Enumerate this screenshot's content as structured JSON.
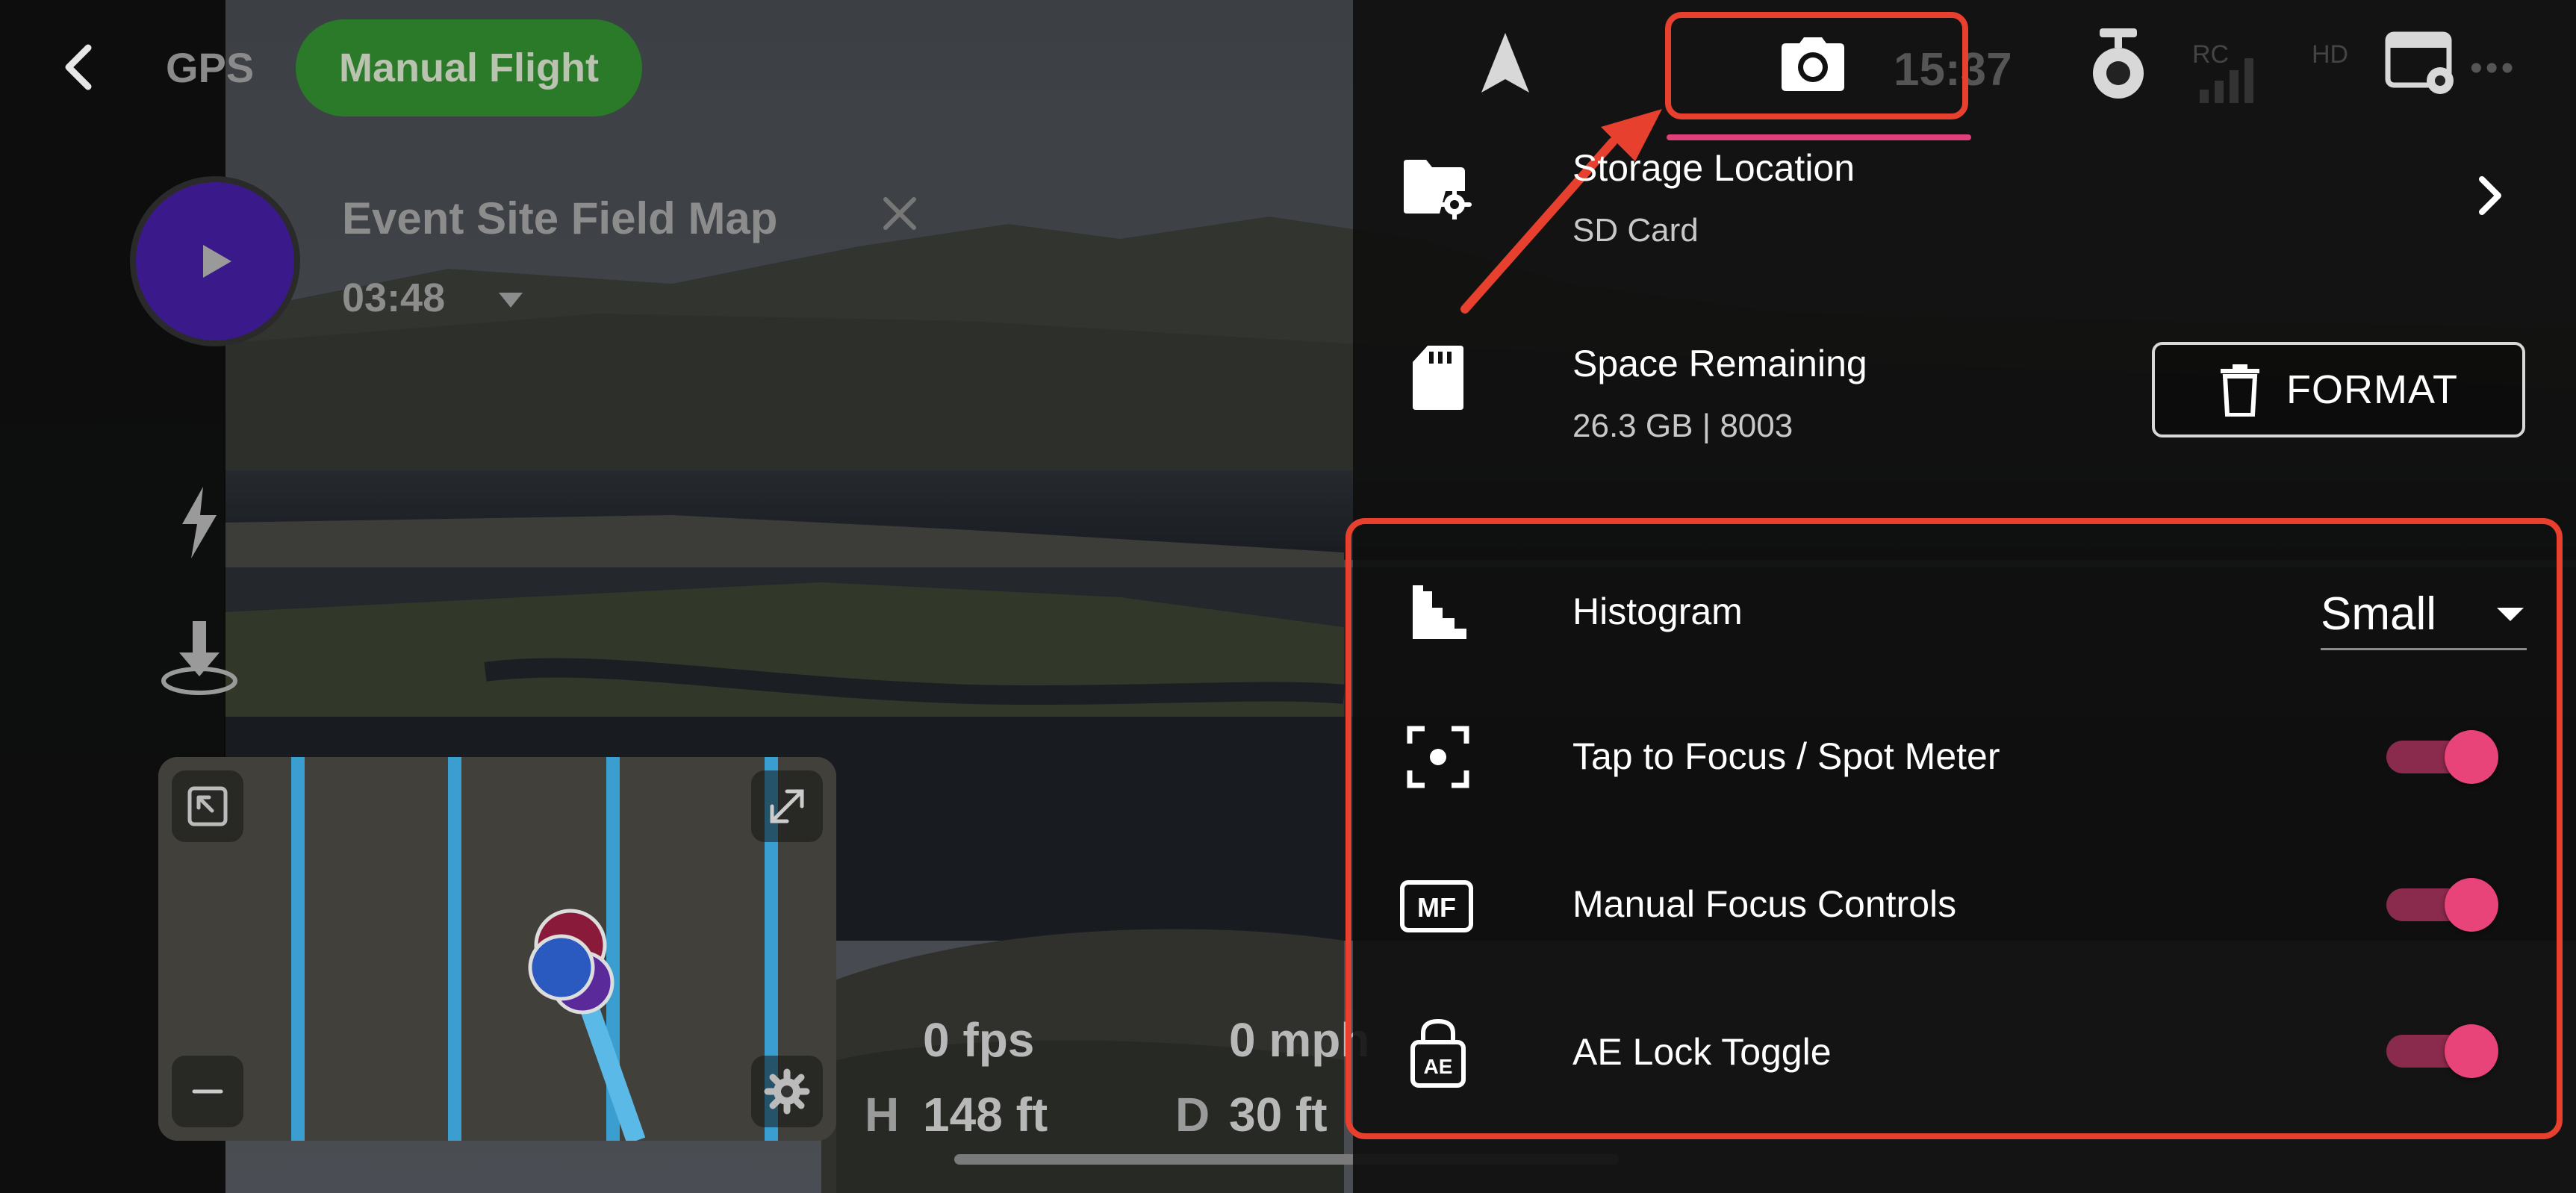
{
  "header": {
    "gps_label": "GPS",
    "flight_mode": "Manual Flight",
    "status_partial": "15:37",
    "rc_label": "RC",
    "hd_label": "HD"
  },
  "mission": {
    "title": "Event Site Field Map",
    "timer": "03:48"
  },
  "telemetry": {
    "fps": "0 fps",
    "speed": "0 mph",
    "height_prefix": "H",
    "height": "148 ft",
    "distance_prefix": "D",
    "distance": "30 ft"
  },
  "storage": {
    "location_title": "Storage Location",
    "location_value": "SD Card",
    "space_title": "Space Remaining",
    "space_value": "26.3 GB | 8003",
    "format_label": "FORMAT"
  },
  "settings": {
    "histogram_label": "Histogram",
    "histogram_value": "Small",
    "tap_focus_label": "Tap to Focus / Spot Meter",
    "manual_focus_label": "Manual Focus Controls",
    "ae_lock_label": "AE Lock Toggle",
    "mf_badge": "MF",
    "ae_badge": "AE"
  },
  "toggles": {
    "tap_focus": true,
    "manual_focus": true,
    "ae_lock": true
  },
  "colors": {
    "accent_pink": "#e8447a",
    "highlight_red": "#e8402e",
    "mode_green": "#2a7a2a",
    "play_purple": "#3a1a8a"
  },
  "icons": {
    "back": "chevron-left-icon",
    "play": "play-icon",
    "bolt": "bolt-icon",
    "download": "download-icon",
    "navigate": "navigation-arrow-icon",
    "camera": "camera-icon",
    "gimbal": "gimbal-icon",
    "settings": "camera-settings-icon",
    "storage": "folder-settings-icon",
    "sd": "sd-card-icon",
    "trash": "trash-icon",
    "histogram": "histogram-icon",
    "focus": "spot-focus-icon",
    "mf": "manual-focus-icon",
    "ae": "ae-lock-icon"
  }
}
